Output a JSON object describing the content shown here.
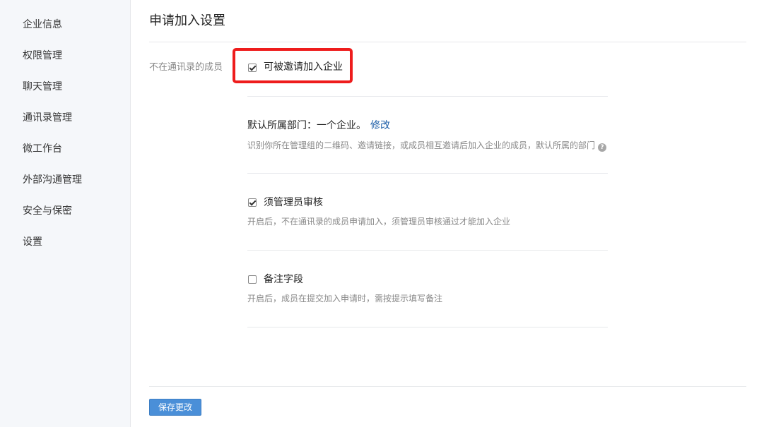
{
  "sidebar": {
    "items": [
      {
        "label": "企业信息"
      },
      {
        "label": "权限管理"
      },
      {
        "label": "聊天管理"
      },
      {
        "label": "通讯录管理"
      },
      {
        "label": "微工作台"
      },
      {
        "label": "外部沟通管理"
      },
      {
        "label": "安全与保密"
      },
      {
        "label": "设置"
      }
    ]
  },
  "main": {
    "title": "申请加入设置",
    "row_label": "不在通讯录的成员",
    "invite_option": {
      "label": "可被邀请加入企业",
      "checked": true
    },
    "department": {
      "text": "默认所属部门：一个企业。",
      "edit_link": "修改",
      "description": "识别你所在管理组的二维码、邀请链接，或成员相互邀请后加入企业的成员，默认所属的部门",
      "help_icon": "?"
    },
    "admin_review": {
      "label": "须管理员审核",
      "checked": true,
      "description": "开启后，不在通讯录的成员申请加入，须管理员审核通过才能加入企业"
    },
    "remark_field": {
      "label": "备注字段",
      "checked": false,
      "description": "开启后，成员在提交加入申请时，需按提示填写备注"
    },
    "save_button": "保存更改"
  },
  "colors": {
    "highlight": "#ee1c1c",
    "link": "#1e5fa8",
    "button": "#4a8fd8",
    "sidebar_bg": "#f5f7fa"
  }
}
